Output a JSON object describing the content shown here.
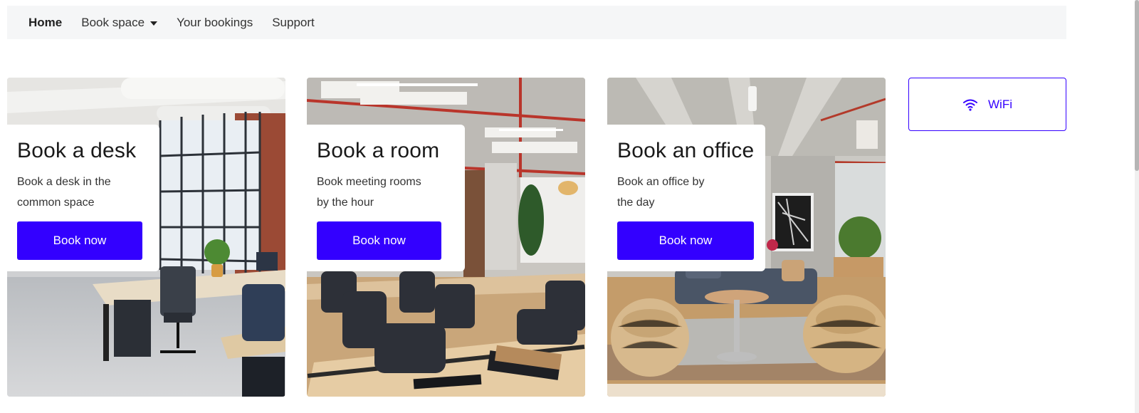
{
  "nav": {
    "items": [
      {
        "label": "Home",
        "active": true
      },
      {
        "label": "Book space",
        "dropdown": true
      },
      {
        "label": "Your bookings"
      },
      {
        "label": "Support"
      }
    ]
  },
  "cards": [
    {
      "title": "Book a desk",
      "desc_line1": "Book a desk in the",
      "desc_line2": "common space",
      "button": "Book now"
    },
    {
      "title": "Book a room",
      "desc_line1": "Book meeting rooms",
      "desc_line2": "by the hour",
      "button": "Book now"
    },
    {
      "title": "Book an office",
      "desc_line1": "Book an office by",
      "desc_line2": "the day",
      "button": "Book now"
    }
  ],
  "wifi": {
    "label": "WiFi",
    "icon": "wifi-icon"
  },
  "colors": {
    "accent": "#3300ff",
    "nav_bg": "#f5f6f7"
  }
}
